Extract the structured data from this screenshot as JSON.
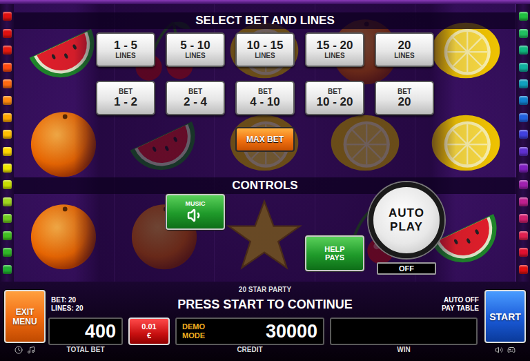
{
  "game": {
    "title": "20 STAR PARTY",
    "status": "PRESS START TO CONTINUE"
  },
  "line_lights": {
    "left": [
      {
        "color": "#e01010"
      },
      {
        "color": "#e01010"
      },
      {
        "color": "#e81a10"
      },
      {
        "color": "#ff4a10"
      },
      {
        "color": "#ff6a10"
      },
      {
        "color": "#ff8a10"
      },
      {
        "color": "#ffa800"
      },
      {
        "color": "#ffc000"
      },
      {
        "color": "#ffd800"
      },
      {
        "color": "#f0e800"
      },
      {
        "color": "#c8e000"
      },
      {
        "color": "#a0d820"
      },
      {
        "color": "#70cc20"
      },
      {
        "color": "#40c020"
      },
      {
        "color": "#30b828"
      },
      {
        "color": "#20b030"
      }
    ],
    "right": [
      {
        "color": "#20c040"
      },
      {
        "color": "#20c060"
      },
      {
        "color": "#10b880"
      },
      {
        "color": "#10b0a0"
      },
      {
        "color": "#10a0c0"
      },
      {
        "color": "#1080d0"
      },
      {
        "color": "#2060e0"
      },
      {
        "color": "#4040e0"
      },
      {
        "color": "#6030d0"
      },
      {
        "color": "#8020c0"
      },
      {
        "color": "#a020b0"
      },
      {
        "color": "#c02090"
      },
      {
        "color": "#d02070"
      },
      {
        "color": "#e02050"
      },
      {
        "color": "#e01030"
      },
      {
        "color": "#e01010"
      }
    ]
  },
  "reels": [
    [
      {
        "kind": "watermelon"
      },
      {
        "kind": "orange"
      },
      {
        "kind": "orange"
      }
    ],
    [
      {
        "kind": "cherry"
      },
      {
        "kind": "watermelon"
      },
      {
        "kind": "orange"
      }
    ],
    [
      {
        "kind": "lemon"
      },
      {
        "kind": "lemon"
      },
      {
        "kind": "star"
      }
    ],
    [
      {
        "kind": "orange"
      },
      {
        "kind": "lemon"
      },
      {
        "kind": "cherry"
      }
    ],
    [
      {
        "kind": "lemon"
      },
      {
        "kind": "lemon"
      },
      {
        "kind": "watermelon"
      }
    ]
  ],
  "menu": {
    "title": "SELECT BET AND LINES",
    "lines_options": [
      {
        "range": "1 - 5",
        "label": "LINES"
      },
      {
        "range": "5 - 10",
        "label": "LINES"
      },
      {
        "range": "10 - 15",
        "label": "LINES"
      },
      {
        "range": "15 - 20",
        "label": "LINES"
      },
      {
        "range": "20",
        "label": "LINES"
      }
    ],
    "bet_options": [
      {
        "label": "BET",
        "range": "1 - 2"
      },
      {
        "label": "BET",
        "range": "2 - 4"
      },
      {
        "label": "BET",
        "range": "4 - 10"
      },
      {
        "label": "BET",
        "range": "10 - 20"
      },
      {
        "label": "BET",
        "range": "20"
      }
    ],
    "max_bet": "MAX BET",
    "controls_title": "CONTROLS",
    "music": {
      "label": "MUSIC",
      "on": true
    },
    "help": "HELP PAYS",
    "auto_play": {
      "label": "AUTO PLAY",
      "status": "OFF",
      "on": false
    }
  },
  "info": {
    "bet": "BET: 20",
    "lines": "LINES: 20",
    "auto": "AUTO OFF",
    "pay_table": "PAY TABLE"
  },
  "buttons": {
    "exit": "EXIT MENU",
    "start": "START"
  },
  "displays": {
    "total_bet": {
      "value": "400",
      "label": "TOTAL BET"
    },
    "coin": {
      "value": "0.01",
      "currency": "€"
    },
    "credit": {
      "mode": "DEMO MODE",
      "value": "30000",
      "label": "CREDIT"
    },
    "win": {
      "label": "WIN"
    }
  }
}
